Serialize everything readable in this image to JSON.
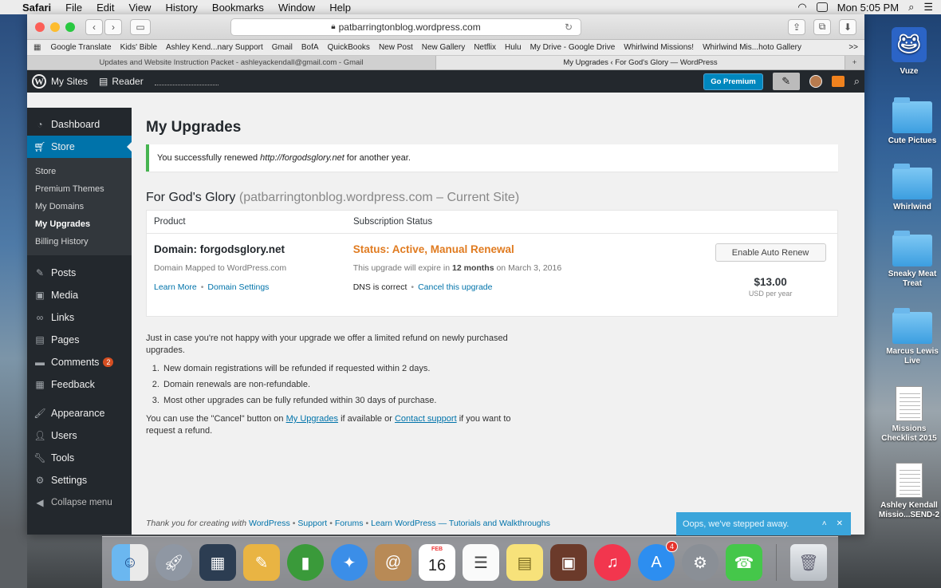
{
  "menubar": {
    "app": "Safari",
    "items": [
      "File",
      "Edit",
      "View",
      "History",
      "Bookmarks",
      "Window",
      "Help"
    ],
    "clock": "Mon 5:05 PM"
  },
  "browser": {
    "address": "patbarringtonblog.wordpress.com",
    "bookmarks": [
      "Google Translate",
      "Kids' Bible",
      "Ashley Kend...nary Support",
      "Gmail",
      "BofA",
      "QuickBooks",
      "New Post",
      "New Gallery",
      "Netflix",
      "Hulu",
      "My Drive - Google Drive",
      "Whirlwind Missions!",
      "Whirlwind Mis...hoto Gallery"
    ],
    "bookmarks_more": ">>",
    "tabs": [
      {
        "label": "Updates and Website Instruction Packet - ashleyackendall@gmail.com - Gmail",
        "active": false
      },
      {
        "label": "My Upgrades ‹ For God's Glory — WordPress",
        "active": true
      }
    ],
    "new_tab": "+"
  },
  "wpbar": {
    "my_sites": "My Sites",
    "reader": "Reader",
    "go_premium": "Go Premium"
  },
  "sidebar": {
    "dashboard": "Dashboard",
    "store": "Store",
    "store_sub": [
      "Store",
      "Premium Themes",
      "My Domains",
      "My Upgrades",
      "Billing History"
    ],
    "posts": "Posts",
    "media": "Media",
    "links": "Links",
    "pages": "Pages",
    "comments": "Comments",
    "comments_count": "2",
    "feedback": "Feedback",
    "appearance": "Appearance",
    "users": "Users",
    "tools": "Tools",
    "settings": "Settings",
    "collapse": "Collapse menu"
  },
  "main": {
    "title": "My Upgrades",
    "notice_before": "You successfully renewed",
    "notice_url": "http://forgodsglory.net",
    "notice_after": "for another year.",
    "site_name": "For God's Glory",
    "site_meta": "(patbarringtonblog.wordpress.com – Current Site)",
    "col_product": "Product",
    "col_status": "Subscription Status",
    "product_name": "Domain: forgodsglory.net",
    "product_desc": "Domain Mapped to WordPress.com",
    "learn_more": "Learn More",
    "domain_settings": "Domain Settings",
    "status": "Status: Active, Manual Renewal",
    "expire_before": "This upgrade will expire in",
    "expire_bold": "12 months",
    "expire_after": "on March 3, 2016",
    "dns": "DNS is correct",
    "cancel_upgrade": "Cancel this upgrade",
    "auto_renew": "Enable Auto Renew",
    "price": "$13.00",
    "price_unit": "USD per year",
    "refund_intro": "Just in case you're not happy with your upgrade we offer a limited refund on newly purchased upgrades.",
    "refund_items": [
      "New domain registrations will be refunded if requested within 2 days.",
      "Domain renewals are non-refundable.",
      "Most other upgrades can be fully refunded within 30 days of purchase."
    ],
    "refund_p1": "You can use the \"Cancel\" button on",
    "refund_link1": "My Upgrades",
    "refund_p2": "if available or",
    "refund_link2": "Contact support",
    "refund_p3": "if you want to request a refund."
  },
  "footer": {
    "thanks": "Thank you for creating with",
    "wordpress": "WordPress",
    "support": "Support",
    "forums": "Forums",
    "learn": "Learn WordPress — Tutorials and Walkthroughs"
  },
  "toast": {
    "text": "Oops, we've stepped away."
  },
  "desktop": {
    "vuze": "Vuze",
    "cute_pictures": "Cute Pictues",
    "whirlwind": "Whirlwind",
    "sneaky_line1": "Sneaky Meat",
    "sneaky_line2": "Treat",
    "marcus_line1": "Marcus Lewis",
    "marcus_line2": "Live",
    "missions_line1": "Missions",
    "missions_line2": "Checklist 2015",
    "ashley_line1": "Ashley Kendall",
    "ashley_line2": "Missio...SEND-2"
  },
  "dock": {
    "calendar_month": "FEB",
    "calendar_day": "16",
    "appstore_badge": "4"
  }
}
